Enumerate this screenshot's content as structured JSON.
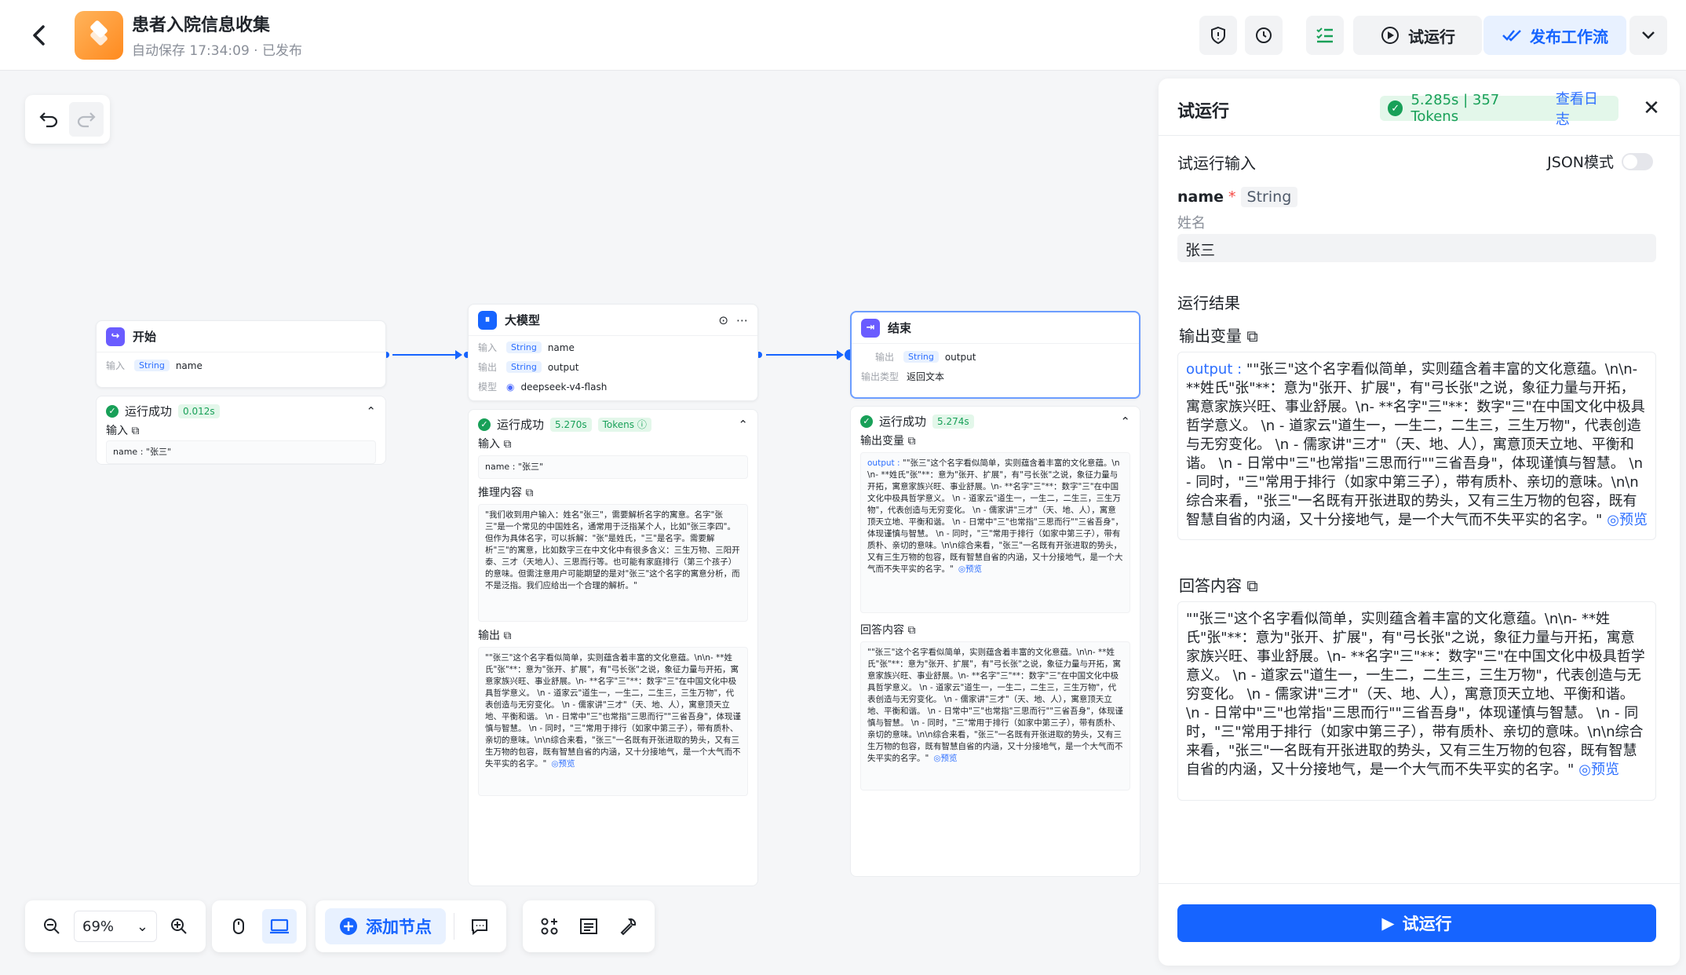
{
  "app": {
    "title": "患者入院信息收集",
    "status": "自动保存 17:34:09 · 已发布"
  },
  "header": {
    "trial_run": "试运行",
    "publish": "发布工作流"
  },
  "zoom": "69%",
  "add_node": "添加节点",
  "nodes": {
    "start": {
      "title": "开始",
      "in_label": "输入",
      "in_type": "String",
      "in_name": "name",
      "status": "运行成功",
      "duration": "0.012s",
      "sub_input": "输入",
      "input_text": "name : \"张三\""
    },
    "llm": {
      "title": "大模型",
      "in_label": "输入",
      "in_type": "String",
      "in_name": "name",
      "out_label": "输出",
      "out_type": "String",
      "out_name": "output",
      "model_label": "模型",
      "model": "deepseek-v4-flash",
      "status": "运行成功",
      "duration": "5.270s",
      "tokens": "Tokens ⓘ",
      "sub_input": "输入",
      "input_text": "name : \"张三\"",
      "sub_reason": "推理内容",
      "reason_text": "\"我们收到用户输入：姓名\"张三\"，需要解析名字的寓意。名字\"张三\"是一个常见的中国姓名，通常用于泛指某个人，比如\"张三李四\"。但作为具体名字，可以拆解：\"张\"是姓氏，\"三\"是名字。需要解析\"三\"的寓意，比如数字三在中文化中有很多含义：三生万物、三阳开泰、三才（天地人）、三思而行等。也可能有家庭排行（第三个孩子）的意味。但需注意用户可能期望的是对\"张三\"这个名字的寓意分析，而不是泛指。我们应给出一个合理的解析。\"",
      "sub_output": "输出",
      "output_text": "\"\"张三\"这个名字看似简单，实则蕴含着丰富的文化意蕴。\\n\\n- **姓氏\"张\"**：意为\"张开、扩展\"，有\"弓长张\"之说，象征力量与开拓，寓意家族兴旺、事业舒展。\\n- **名字\"三\"**：数字\"三\"在中国文化中极具哲学意义。 \\n - 道家云\"道生一，一生二，二生三，三生万物\"，代表创造与无穷变化。 \\n - 儒家讲\"三才\"（天、地、人），寓意顶天立地、平衡和谐。 \\n - 日常中\"三\"也常指\"三思而行\"\"三省吾身\"，体现谨慎与智慧。 \\n - 同时，\"三\"常用于排行（如家中第三子），带有质朴、亲切的意味。\\n\\n综合来看，\"张三\"一名既有开张进取的势头，又有三生万物的包容，既有智慧自省的内涵，又十分接地气，是一个大气而不失平实的名字。\"",
      "preview": "◎预览"
    },
    "end": {
      "title": "结束",
      "out_label": "输出",
      "out_type": "String",
      "out_name": "output",
      "type_label": "输出类型",
      "type_value": "返回文本",
      "status": "运行成功",
      "duration": "5.274s",
      "sub_out_var": "输出变量",
      "out_var_key": "output : ",
      "out_var_text": "\"\"张三\"这个名字看似简单，实则蕴含着丰富的文化意蕴。\\n\\n- **姓氏\"张\"**：意为\"张开、扩展\"，有\"弓长张\"之说，象征力量与开拓，寓意家族兴旺、事业舒展。\\n- **名字\"三\"**：数字\"三\"在中国文化中极具哲学意义。 \\n - 道家云\"道生一，一生二，二生三，三生万物\"，代表创造与无穷变化。 \\n - 儒家讲\"三才\"（天、地、人），寓意顶天立地、平衡和谐。 \\n - 日常中\"三\"也常指\"三思而行\"\"三省吾身\"，体现谨慎与智慧。 \\n - 同时，\"三\"常用于排行（如家中第三子），带有质朴、亲切的意味。\\n\\n综合来看，\"张三\"一名既有开张进取的势头，又有三生万物的包容，既有智慧自省的内涵，又十分接地气，是一个大气而不失平实的名字。\"",
      "sub_answer": "回答内容",
      "answer_text": "\"\"张三\"这个名字看似简单，实则蕴含着丰富的文化意蕴。\\n\\n- **姓氏\"张\"**：意为\"张开、扩展\"，有\"弓长张\"之说，象征力量与开拓，寓意家族兴旺、事业舒展。\\n- **名字\"三\"**：数字\"三\"在中国文化中极具哲学意义。 \\n - 道家云\"道生一，一生二，二生三，三生万物\"，代表创造与无穷变化。 \\n - 儒家讲\"三才\"（天、地、人），寓意顶天立地、平衡和谐。 \\n - 日常中\"三\"也常指\"三思而行\"\"三省吾身\"，体现谨慎与智慧。 \\n - 同时，\"三\"常用于排行（如家中第三子），带有质朴、亲切的意味。\\n\\n综合来看，\"张三\"一名既有开张进取的势头，又有三生万物的包容，既有智慧自省的内涵，又十分接地气，是一个大气而不失平实的名字。\"",
      "preview": "◎预览"
    }
  },
  "panel": {
    "title": "试运行",
    "badge": "5.285s | 357 Tokens",
    "log": "查看日志",
    "input_section": "试运行输入",
    "json_mode": "JSON模式",
    "field_name": "name",
    "field_required": "*",
    "field_type": "String",
    "field_desc": "姓名",
    "field_value": "张三",
    "result_section": "运行结果",
    "out_var_title": "输出变量",
    "out_key": "output : ",
    "out_text": "\"\"张三\"这个名字看似简单，实则蕴含着丰富的文化意蕴。\\n\\n- **姓氏\"张\"**：意为\"张开、扩展\"，有\"弓长张\"之说，象征力量与开拓，寓意家族兴旺、事业舒展。\\n- **名字\"三\"**：数字\"三\"在中国文化中极具哲学意义。 \\n - 道家云\"道生一，一生二，二生三，三生万物\"，代表创造与无穷变化。 \\n - 儒家讲\"三才\"（天、地、人），寓意顶天立地、平衡和谐。 \\n - 日常中\"三\"也常指\"三思而行\"\"三省吾身\"，体现谨慎与智慧。 \\n - 同时，\"三\"常用于排行（如家中第三子），带有质朴、亲切的意味。\\n\\n综合来看，\"张三\"一名既有开张进取的势头，又有三生万物的包容，既有智慧自省的内涵，又十分接地气，是一个大气而不失平实的名字。\"",
    "answer_title": "回答内容",
    "answer_text": "\"\"张三\"这个名字看似简单，实则蕴含着丰富的文化意蕴。\\n\\n- **姓氏\"张\"**：意为\"张开、扩展\"，有\"弓长张\"之说，象征力量与开拓，寓意家族兴旺、事业舒展。\\n- **名字\"三\"**：数字\"三\"在中国文化中极具哲学意义。 \\n - 道家云\"道生一，一生二，二生三，三生万物\"，代表创造与无穷变化。 \\n - 儒家讲\"三才\"（天、地、人），寓意顶天立地、平衡和谐。 \\n - 日常中\"三\"也常指\"三思而行\"\"三省吾身\"，体现谨慎与智慧。 \\n - 同时，\"三\"常用于排行（如家中第三子），带有质朴、亲切的意味。\\n\\n综合来看，\"张三\"一名既有开张进取的势头，又有三生万物的包容，既有智慧自省的内涵，又十分接地气，是一个大气而不失平实的名字。\"",
    "preview": "◎预览",
    "run_button": "试运行"
  },
  "colors": {
    "accent": "#1664ff",
    "success": "#18a058",
    "brand_orange": "#ff8a1f"
  }
}
